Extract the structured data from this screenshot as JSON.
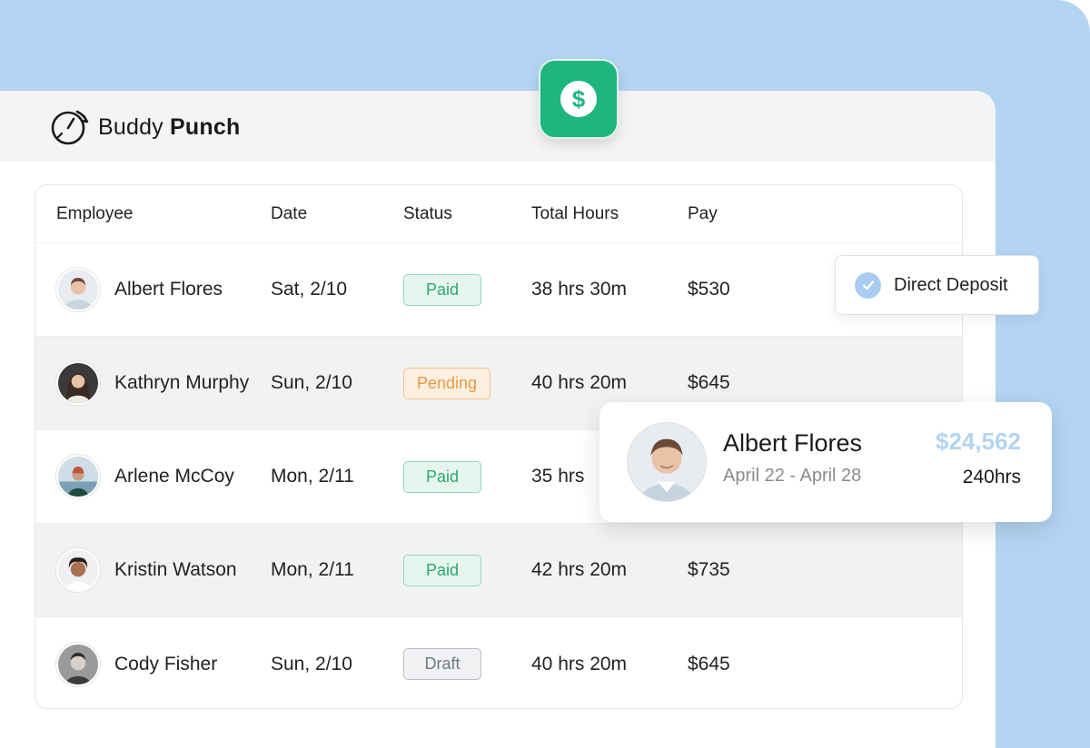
{
  "brand": {
    "name_light": "Buddy",
    "name_bold": "Punch",
    "accent_green": "#1fb57f",
    "accent_blue": "#b3d4f2"
  },
  "badge_icon": "dollar-icon",
  "dollar_symbol": "$",
  "table": {
    "headers": {
      "employee": "Employee",
      "date": "Date",
      "status": "Status",
      "total_hours": "Total Hours",
      "pay": "Pay"
    },
    "rows": [
      {
        "name": "Albert Flores",
        "date": "Sat, 2/10",
        "status": "Paid",
        "status_kind": "paid",
        "hours": "38 hrs 30m",
        "pay": "$530"
      },
      {
        "name": "Kathryn Murphy",
        "date": "Sun, 2/10",
        "status": "Pending",
        "status_kind": "pending",
        "hours": "40 hrs 20m",
        "pay": "$645"
      },
      {
        "name": "Arlene McCoy",
        "date": "Mon, 2/11",
        "status": "Paid",
        "status_kind": "paid",
        "hours": "35 hrs",
        "pay": ""
      },
      {
        "name": "Kristin Watson",
        "date": "Mon, 2/11",
        "status": "Paid",
        "status_kind": "paid",
        "hours": "42 hrs 20m",
        "pay": "$735"
      },
      {
        "name": "Cody Fisher",
        "date": "Sun, 2/10",
        "status": "Draft",
        "status_kind": "draft",
        "hours": "40 hrs 20m",
        "pay": "$645"
      }
    ]
  },
  "deposit_popup": {
    "label": "Direct Deposit",
    "icon": "check-circle-icon"
  },
  "profile_popup": {
    "name": "Albert Flores",
    "range": "April 22 - April 28",
    "amount": "$24,562",
    "hours": "240hrs"
  }
}
